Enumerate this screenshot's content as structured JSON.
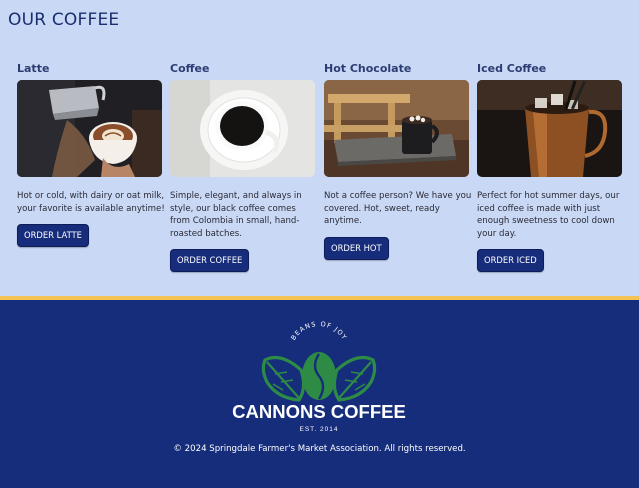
{
  "section": {
    "title": "OUR COFFEE"
  },
  "cards": [
    {
      "title": "Latte",
      "description": "Hot or cold, with dairy or oat milk, your favorite is available anytime!",
      "button_label": "ORDER LATTE"
    },
    {
      "title": "Coffee",
      "description": "Simple, elegant, and always in style, our black coffee comes from Colombia in small, hand-roasted batches.",
      "button_label": "ORDER COFFEE"
    },
    {
      "title": "Hot Chocolate",
      "description": "Not a coffee person? We have you covered. Hot, sweet, ready anytime.",
      "button_label": "ORDER HOT"
    },
    {
      "title": "Iced Coffee",
      "description": "Perfect for hot summer days, our iced coffee is made with just enough sweetness to cool down your day.",
      "button_label": "ORDER ICED"
    }
  ],
  "footer": {
    "logo": {
      "tagline": "BEANS OF JOY",
      "name": "CANNONS COFFEE",
      "established": "EST. 2014"
    },
    "copyright": "© 2024 Springdale Farmer's Market Association. All rights reserved."
  },
  "colors": {
    "page_background": "#c9d8f4",
    "footer_background": "#152d7b",
    "button_background": "#172d7c",
    "divider": "#f3c455",
    "logo_green": "#2e8b45"
  }
}
